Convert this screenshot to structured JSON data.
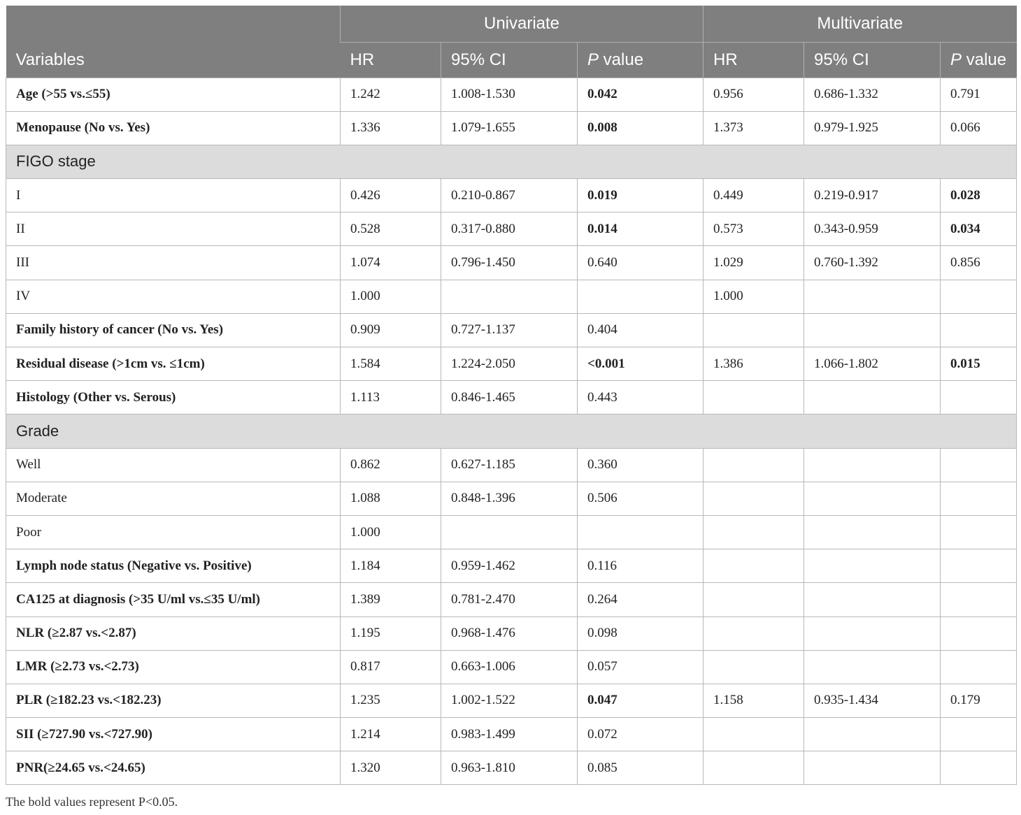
{
  "header": {
    "variables": "Variables",
    "univariate": "Univariate",
    "multivariate": "Multivariate",
    "hr": "HR",
    "ci": "95% CI",
    "p_italic": "P",
    "p_rest": " value"
  },
  "rows": [
    {
      "type": "data",
      "bold_label": true,
      "label": "Age (>55 vs.≤55)",
      "u_hr": "1.242",
      "u_ci": "1.008-1.530",
      "u_p": "0.042",
      "u_p_bold": true,
      "m_hr": "0.956",
      "m_ci": "0.686-1.332",
      "m_p": "0.791",
      "m_p_bold": false
    },
    {
      "type": "data",
      "bold_label": true,
      "label": "Menopause (No vs. Yes)",
      "u_hr": "1.336",
      "u_ci": "1.079-1.655",
      "u_p": "0.008",
      "u_p_bold": true,
      "m_hr": "1.373",
      "m_ci": "0.979-1.925",
      "m_p": "0.066",
      "m_p_bold": false
    },
    {
      "type": "section",
      "label": "FIGO stage"
    },
    {
      "type": "data",
      "bold_label": false,
      "label": "I",
      "u_hr": "0.426",
      "u_ci": "0.210-0.867",
      "u_p": "0.019",
      "u_p_bold": true,
      "m_hr": "0.449",
      "m_ci": "0.219-0.917",
      "m_p": "0.028",
      "m_p_bold": true
    },
    {
      "type": "data",
      "bold_label": false,
      "label": "II",
      "u_hr": "0.528",
      "u_ci": "0.317-0.880",
      "u_p": "0.014",
      "u_p_bold": true,
      "m_hr": "0.573",
      "m_ci": "0.343-0.959",
      "m_p": "0.034",
      "m_p_bold": true
    },
    {
      "type": "data",
      "bold_label": false,
      "label": "III",
      "u_hr": "1.074",
      "u_ci": "0.796-1.450",
      "u_p": "0.640",
      "u_p_bold": false,
      "m_hr": "1.029",
      "m_ci": "0.760-1.392",
      "m_p": "0.856",
      "m_p_bold": false
    },
    {
      "type": "data",
      "bold_label": false,
      "label": "IV",
      "u_hr": "1.000",
      "u_ci": "",
      "u_p": "",
      "u_p_bold": false,
      "m_hr": "1.000",
      "m_ci": "",
      "m_p": "",
      "m_p_bold": false
    },
    {
      "type": "data",
      "bold_label": true,
      "label": "Family history of cancer (No vs. Yes)",
      "u_hr": "0.909",
      "u_ci": "0.727-1.137",
      "u_p": "0.404",
      "u_p_bold": false,
      "m_hr": "",
      "m_ci": "",
      "m_p": "",
      "m_p_bold": false
    },
    {
      "type": "data",
      "bold_label": true,
      "label": "Residual disease (>1cm vs. ≤1cm)",
      "u_hr": "1.584",
      "u_ci": "1.224-2.050",
      "u_p": "<0.001",
      "u_p_bold": true,
      "m_hr": "1.386",
      "m_ci": "1.066-1.802",
      "m_p": "0.015",
      "m_p_bold": true
    },
    {
      "type": "data",
      "bold_label": true,
      "label": "Histology (Other vs. Serous)",
      "u_hr": "1.113",
      "u_ci": "0.846-1.465",
      "u_p": "0.443",
      "u_p_bold": false,
      "m_hr": "",
      "m_ci": "",
      "m_p": "",
      "m_p_bold": false
    },
    {
      "type": "section",
      "label": "Grade"
    },
    {
      "type": "data",
      "bold_label": false,
      "label": "Well",
      "u_hr": "0.862",
      "u_ci": "0.627-1.185",
      "u_p": "0.360",
      "u_p_bold": false,
      "m_hr": "",
      "m_ci": "",
      "m_p": "",
      "m_p_bold": false
    },
    {
      "type": "data",
      "bold_label": false,
      "label": "Moderate",
      "u_hr": "1.088",
      "u_ci": "0.848-1.396",
      "u_p": "0.506",
      "u_p_bold": false,
      "m_hr": "",
      "m_ci": "",
      "m_p": "",
      "m_p_bold": false
    },
    {
      "type": "data",
      "bold_label": false,
      "label": "Poor",
      "u_hr": "1.000",
      "u_ci": "",
      "u_p": "",
      "u_p_bold": false,
      "m_hr": "",
      "m_ci": "",
      "m_p": "",
      "m_p_bold": false
    },
    {
      "type": "data",
      "bold_label": true,
      "label": "Lymph node status (Negative vs. Positive)",
      "u_hr": "1.184",
      "u_ci": "0.959-1.462",
      "u_p": "0.116",
      "u_p_bold": false,
      "m_hr": "",
      "m_ci": "",
      "m_p": "",
      "m_p_bold": false
    },
    {
      "type": "data",
      "bold_label": true,
      "label": "CA125 at diagnosis (>35 U/ml vs.≤35 U/ml)",
      "u_hr": "1.389",
      "u_ci": "0.781-2.470",
      "u_p": "0.264",
      "u_p_bold": false,
      "m_hr": "",
      "m_ci": "",
      "m_p": "",
      "m_p_bold": false
    },
    {
      "type": "data",
      "bold_label": true,
      "label": "NLR (≥2.87 vs.<2.87)",
      "u_hr": "1.195",
      "u_ci": "0.968-1.476",
      "u_p": "0.098",
      "u_p_bold": false,
      "m_hr": "",
      "m_ci": "",
      "m_p": "",
      "m_p_bold": false
    },
    {
      "type": "data",
      "bold_label": true,
      "label": "LMR (≥2.73 vs.<2.73)",
      "u_hr": "0.817",
      "u_ci": "0.663-1.006",
      "u_p": "0.057",
      "u_p_bold": false,
      "m_hr": "",
      "m_ci": "",
      "m_p": "",
      "m_p_bold": false
    },
    {
      "type": "data",
      "bold_label": true,
      "label": "PLR (≥182.23 vs.<182.23)",
      "u_hr": "1.235",
      "u_ci": "1.002-1.522",
      "u_p": "0.047",
      "u_p_bold": true,
      "m_hr": "1.158",
      "m_ci": "0.935-1.434",
      "m_p": "0.179",
      "m_p_bold": false
    },
    {
      "type": "data",
      "bold_label": true,
      "label": "SII (≥727.90 vs.<727.90)",
      "u_hr": "1.214",
      "u_ci": "0.983-1.499",
      "u_p": "0.072",
      "u_p_bold": false,
      "m_hr": "",
      "m_ci": "",
      "m_p": "",
      "m_p_bold": false
    },
    {
      "type": "data",
      "bold_label": true,
      "label": "PNR(≥24.65 vs.<24.65)",
      "u_hr": "1.320",
      "u_ci": "0.963-1.810",
      "u_p": "0.085",
      "u_p_bold": false,
      "m_hr": "",
      "m_ci": "",
      "m_p": "",
      "m_p_bold": false
    }
  ],
  "footnote": "The bold values represent P<0.05."
}
